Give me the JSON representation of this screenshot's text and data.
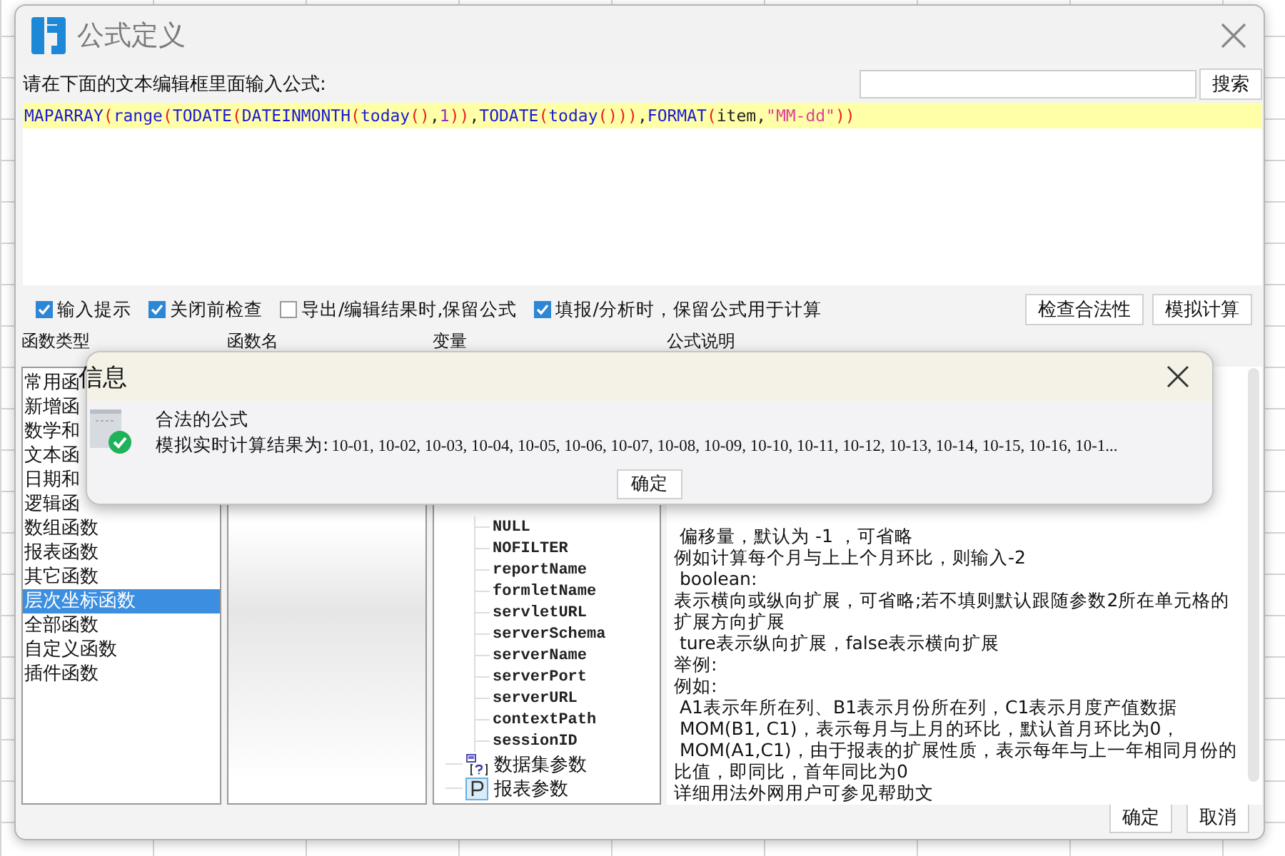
{
  "window": {
    "title": "公式定义"
  },
  "prompt": "请在下面的文本编辑框里面输入公式:",
  "search_button": "搜索",
  "formula": [
    {
      "kind": "fn",
      "text": "MAPARRAY"
    },
    {
      "kind": "paren",
      "text": "("
    },
    {
      "kind": "fn",
      "text": "range"
    },
    {
      "kind": "paren",
      "text": "("
    },
    {
      "kind": "fn",
      "text": "TODATE"
    },
    {
      "kind": "paren",
      "text": "("
    },
    {
      "kind": "fn",
      "text": "DATEINMONTH"
    },
    {
      "kind": "paren",
      "text": "("
    },
    {
      "kind": "fn",
      "text": "today"
    },
    {
      "kind": "paren",
      "text": "()"
    },
    {
      "kind": "sep",
      "text": ","
    },
    {
      "kind": "num",
      "text": "1"
    },
    {
      "kind": "paren",
      "text": "))"
    },
    {
      "kind": "sep",
      "text": ","
    },
    {
      "kind": "fn",
      "text": "TODATE"
    },
    {
      "kind": "paren",
      "text": "("
    },
    {
      "kind": "fn",
      "text": "today"
    },
    {
      "kind": "paren",
      "text": "()))"
    },
    {
      "kind": "sep",
      "text": ","
    },
    {
      "kind": "fn",
      "text": "FORMAT"
    },
    {
      "kind": "paren",
      "text": "("
    },
    {
      "kind": "var",
      "text": "item"
    },
    {
      "kind": "sep",
      "text": ","
    },
    {
      "kind": "str",
      "text": "\"MM-dd\""
    },
    {
      "kind": "paren",
      "text": "))"
    }
  ],
  "options": [
    {
      "label": "输入提示",
      "checked": true
    },
    {
      "label": "关闭前检查",
      "checked": true
    },
    {
      "label": "导出/编辑结果时,保留公式",
      "checked": false
    },
    {
      "label": "填报/分析时，保留公式用于计算",
      "checked": true
    }
  ],
  "action_buttons": [
    "检查合法性",
    "模拟计算"
  ],
  "columns": [
    "函数类型",
    "函数名",
    "变量",
    "公式说明"
  ],
  "categories": [
    {
      "label": "常用函",
      "selected": false
    },
    {
      "label": "新增函",
      "selected": false
    },
    {
      "label": "数学和",
      "selected": false
    },
    {
      "label": "文本函",
      "selected": false
    },
    {
      "label": "日期和",
      "selected": false
    },
    {
      "label": "逻辑函",
      "selected": false
    },
    {
      "label": "数组函数",
      "selected": false
    },
    {
      "label": "报表函数",
      "selected": false
    },
    {
      "label": "其它函数",
      "selected": false
    },
    {
      "label": "层次坐标函数",
      "selected": true
    },
    {
      "label": "全部函数",
      "selected": false
    },
    {
      "label": "自定义函数",
      "selected": false
    },
    {
      "label": "插件函数",
      "selected": false
    }
  ],
  "variables": [
    {
      "kind": "hidden-group",
      "children": [
        {
          "label": "NULL"
        },
        {
          "label": "NOFILTER"
        },
        {
          "label": "reportName"
        },
        {
          "label": "formletName"
        },
        {
          "label": "servletURL"
        },
        {
          "label": "serverSchema"
        },
        {
          "label": "serverName"
        },
        {
          "label": "serverPort"
        },
        {
          "label": "serverURL"
        },
        {
          "label": "contextPath"
        },
        {
          "label": "sessionID"
        }
      ]
    },
    {
      "kind": "dataset",
      "label": "数据集参数"
    },
    {
      "kind": "report",
      "label": "报表参数"
    }
  ],
  "description": [
    " 偏移量，默认为 -1 ，可省略",
    "例如计算每个月与上上个月环比，则输入-2",
    " boolean:",
    "表示横向或纵向扩展，可省略;若不填则默认跟随参数2所在单元格的扩展方向扩展",
    " ture表示纵向扩展，false表示横向扩展",
    "举例:",
    "例如:",
    " A1表示年所在列、B1表示月份所在列，C1表示月度产值数据",
    " MOM(B1, C1)，表示每月与上月的环比，默认首月环比为0，",
    " MOM(A1,C1)，由于报表的扩展性质，表示每年与上一年相同月份的比值，即同比，首年同比为0",
    "详细用法外网用户可参见帮助文"
  ],
  "footer_buttons": [
    "确定",
    "取消"
  ],
  "message_dialog": {
    "title": "信息",
    "heading": "合法的公式",
    "label": "模拟实时计算结果为:",
    "result": "10-01, 10-02, 10-03, 10-04, 10-05, 10-06, 10-07, 10-08, 10-09, 10-10, 10-11, 10-12, 10-13, 10-14, 10-15, 10-16, 10-1...",
    "button": "确定"
  }
}
